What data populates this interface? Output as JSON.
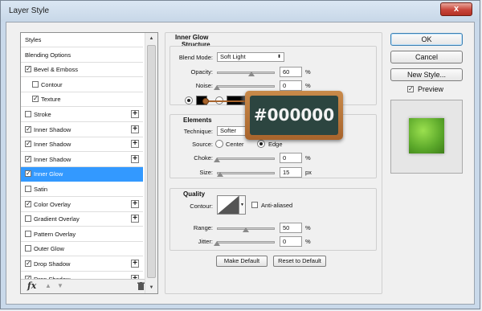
{
  "window": {
    "title": "Layer Style",
    "close_symbol": "x"
  },
  "styles_list": {
    "items": [
      {
        "label": "Styles",
        "checkbox": false,
        "checked": false,
        "plus": false,
        "indent": false,
        "selected": false
      },
      {
        "label": "Blending Options",
        "checkbox": false,
        "checked": false,
        "plus": false,
        "indent": false,
        "selected": false
      },
      {
        "label": "Bevel & Emboss",
        "checkbox": true,
        "checked": true,
        "plus": false,
        "indent": false,
        "selected": false
      },
      {
        "label": "Contour",
        "checkbox": true,
        "checked": false,
        "plus": false,
        "indent": true,
        "selected": false
      },
      {
        "label": "Texture",
        "checkbox": true,
        "checked": true,
        "plus": false,
        "indent": true,
        "selected": false
      },
      {
        "label": "Stroke",
        "checkbox": true,
        "checked": false,
        "plus": true,
        "indent": false,
        "selected": false
      },
      {
        "label": "Inner Shadow",
        "checkbox": true,
        "checked": true,
        "plus": true,
        "indent": false,
        "selected": false
      },
      {
        "label": "Inner Shadow",
        "checkbox": true,
        "checked": true,
        "plus": true,
        "indent": false,
        "selected": false
      },
      {
        "label": "Inner Shadow",
        "checkbox": true,
        "checked": true,
        "plus": true,
        "indent": false,
        "selected": false
      },
      {
        "label": "Inner Glow",
        "checkbox": true,
        "checked": true,
        "plus": false,
        "indent": false,
        "selected": true
      },
      {
        "label": "Satin",
        "checkbox": true,
        "checked": false,
        "plus": false,
        "indent": false,
        "selected": false
      },
      {
        "label": "Color Overlay",
        "checkbox": true,
        "checked": true,
        "plus": true,
        "indent": false,
        "selected": false
      },
      {
        "label": "Gradient Overlay",
        "checkbox": true,
        "checked": false,
        "plus": true,
        "indent": false,
        "selected": false
      },
      {
        "label": "Pattern Overlay",
        "checkbox": true,
        "checked": false,
        "plus": false,
        "indent": false,
        "selected": false
      },
      {
        "label": "Outer Glow",
        "checkbox": true,
        "checked": false,
        "plus": false,
        "indent": false,
        "selected": false
      },
      {
        "label": "Drop Shadow",
        "checkbox": true,
        "checked": true,
        "plus": true,
        "indent": false,
        "selected": false
      },
      {
        "label": "Drop Shadow",
        "checkbox": true,
        "checked": true,
        "plus": true,
        "indent": false,
        "selected": false
      }
    ],
    "footer": {
      "fx_label": "fx"
    }
  },
  "inner_glow": {
    "section_title": "Inner Glow",
    "structure": {
      "title": "Structure",
      "blend_mode_label": "Blend Mode:",
      "blend_mode_value": "Soft Light",
      "opacity_label": "Opacity:",
      "opacity_value": "60",
      "opacity_level": 0.6,
      "noise_label": "Noise:",
      "noise_value": "0",
      "noise_level": 0.0,
      "percent": "%"
    },
    "elements": {
      "title": "Elements",
      "technique_label": "Technique:",
      "technique_value": "Softer",
      "source_label": "Source:",
      "source_center": "Center",
      "source_edge": "Edge",
      "source_selected": "Edge",
      "choke_label": "Choke:",
      "choke_value": "0",
      "choke_level": 0.0,
      "size_label": "Size:",
      "size_value": "15",
      "size_level": 0.06,
      "px": "px"
    },
    "quality": {
      "title": "Quality",
      "contour_label": "Contour:",
      "anti_aliased_label": "Anti-aliased",
      "anti_aliased_checked": false,
      "range_label": "Range:",
      "range_value": "50",
      "range_level": 0.5,
      "jitter_label": "Jitter:",
      "jitter_value": "0",
      "jitter_level": 0.0
    },
    "make_default_label": "Make Default",
    "reset_default_label": "Reset to Default"
  },
  "callout": {
    "text": "#000000",
    "board_color": "#2c4540",
    "frame_color": "#a8642c"
  },
  "actions": {
    "ok_label": "OK",
    "cancel_label": "Cancel",
    "new_style_label": "New Style...",
    "preview_label": "Preview",
    "preview_checked": true
  },
  "colors": {
    "selection": "#3399ff",
    "glow_color": "#000000",
    "preview_swatch": "#5ba82a"
  }
}
